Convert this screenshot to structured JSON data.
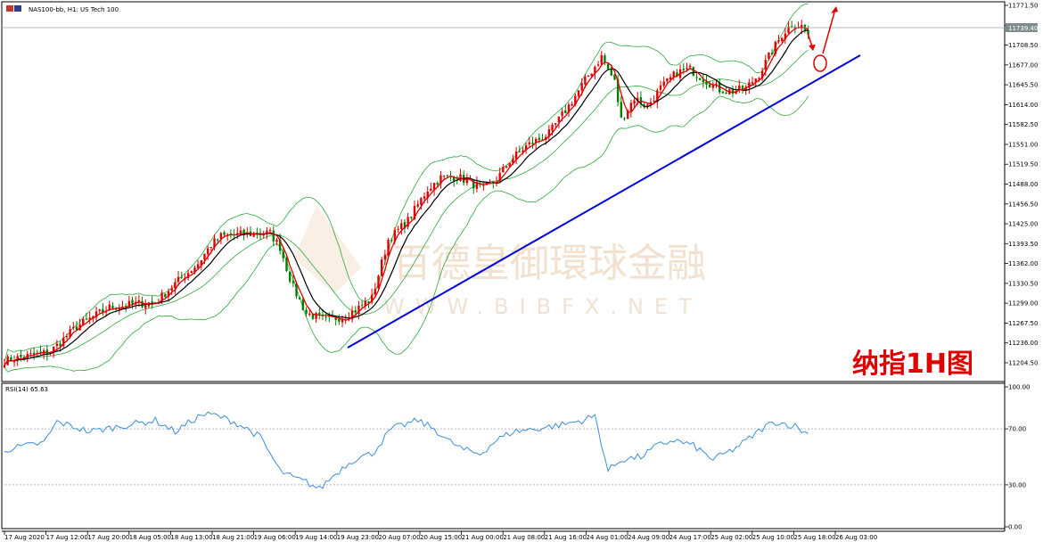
{
  "header": {
    "symbol_text": "NAS100-bb, H1:  US Tech 100",
    "rsi_label": "RSI(14) 65.63"
  },
  "annotation": {
    "title": "纳指1H图",
    "watermark_cn": "百德皇御環球金融",
    "watermark_en": "WWW.BIBFX.NET"
  },
  "colors": {
    "bull": "#e00000",
    "bear": "#008000",
    "trendline": "#0000dd",
    "bands": "#2fa83c",
    "fast_ma": "#e00000",
    "slow_ma": "#000000",
    "rsi": "#3b8ed8",
    "arrow": "#e00000"
  },
  "chart_data": [
    {
      "type": "candlestick",
      "symbol": "NAS100-bb",
      "timeframe": "H1",
      "ylim": [
        11190,
        11775
      ],
      "y_ticks": [
        "11771.50",
        "11739.40",
        "11708.50",
        "11677.00",
        "11645.50",
        "11614.00",
        "11582.50",
        "11551.00",
        "11519.50",
        "11488.00",
        "11456.50",
        "11425.00",
        "11393.50",
        "11362.00",
        "11330.50",
        "11299.00",
        "11267.50",
        "11236.00",
        "11204.50"
      ],
      "current_price": "11739.40",
      "x_ticks": [
        "17 Aug 2020",
        "17 Aug 12:00",
        "17 Aug 20:00",
        "18 Aug 05:00",
        "18 Aug 13:00",
        "18 Aug 21:00",
        "19 Aug 06:00",
        "19 Aug 14:00",
        "19 Aug 23:00",
        "20 Aug 07:00",
        "20 Aug 15:00",
        "21 Aug 00:00",
        "21 Aug 08:00",
        "21 Aug 16:00",
        "24 Aug 01:00",
        "24 Aug 09:00",
        "24 Aug 17:00",
        "25 Aug 02:00",
        "25 Aug 10:00",
        "25 Aug 18:00",
        "26 Aug 03:00"
      ],
      "overlays": [
        "Bollinger Bands",
        "fast moving average (red)",
        "slow moving average (black)",
        "rising trendline (blue)"
      ],
      "close_path": [
        [
          0,
          11208
        ],
        [
          14,
          11222
        ],
        [
          22,
          11262
        ],
        [
          32,
          11292
        ],
        [
          40,
          11298
        ],
        [
          46,
          11300
        ],
        [
          52,
          11330
        ],
        [
          59,
          11362
        ],
        [
          63,
          11392
        ],
        [
          66,
          11405
        ],
        [
          72,
          11408
        ],
        [
          78,
          11410
        ],
        [
          81,
          11410
        ],
        [
          84,
          11388
        ],
        [
          86,
          11355
        ],
        [
          88,
          11324
        ],
        [
          92,
          11283
        ],
        [
          98,
          11272
        ],
        [
          104,
          11279
        ],
        [
          108,
          11292
        ],
        [
          112,
          11307
        ],
        [
          117,
          11400
        ],
        [
          123,
          11430
        ],
        [
          129,
          11480
        ],
        [
          133,
          11498
        ],
        [
          138,
          11500
        ],
        [
          142,
          11490
        ],
        [
          146,
          11480
        ],
        [
          150,
          11495
        ],
        [
          154,
          11525
        ],
        [
          159,
          11548
        ],
        [
          166,
          11568
        ],
        [
          172,
          11612
        ],
        [
          178,
          11660
        ],
        [
          182,
          11690
        ],
        [
          186,
          11650
        ],
        [
          188,
          11590
        ],
        [
          192,
          11625
        ],
        [
          196,
          11612
        ],
        [
          200,
          11640
        ],
        [
          205,
          11665
        ],
        [
          209,
          11670
        ],
        [
          213,
          11655
        ],
        [
          218,
          11638
        ],
        [
          222,
          11635
        ],
        [
          226,
          11640
        ],
        [
          230,
          11662
        ],
        [
          233,
          11690
        ],
        [
          237,
          11725
        ],
        [
          240,
          11742
        ],
        [
          243,
          11738
        ],
        [
          245,
          11725
        ]
      ],
      "n_candles": 246
    },
    {
      "type": "line",
      "indicator": "RSI(14)",
      "value": 65.63,
      "ylim": [
        0,
        100
      ],
      "y_ticks": [
        "100.00",
        "70.00",
        "30.00",
        "0.00"
      ],
      "levels": [
        70,
        30
      ],
      "path": [
        [
          0,
          55
        ],
        [
          12,
          60
        ],
        [
          16,
          75
        ],
        [
          26,
          68
        ],
        [
          38,
          73
        ],
        [
          46,
          76
        ],
        [
          52,
          68
        ],
        [
          60,
          80
        ],
        [
          64,
          80
        ],
        [
          70,
          75
        ],
        [
          74,
          70
        ],
        [
          78,
          64
        ],
        [
          81,
          52
        ],
        [
          84,
          40
        ],
        [
          88,
          35
        ],
        [
          92,
          32
        ],
        [
          96,
          27
        ],
        [
          100,
          36
        ],
        [
          104,
          44
        ],
        [
          108,
          50
        ],
        [
          112,
          52
        ],
        [
          118,
          70
        ],
        [
          126,
          76
        ],
        [
          131,
          70
        ],
        [
          135,
          62
        ],
        [
          140,
          55
        ],
        [
          145,
          52
        ],
        [
          150,
          62
        ],
        [
          155,
          68
        ],
        [
          162,
          70
        ],
        [
          170,
          73
        ],
        [
          176,
          76
        ],
        [
          180,
          79
        ],
        [
          184,
          40
        ],
        [
          188,
          48
        ],
        [
          194,
          50
        ],
        [
          199,
          58
        ],
        [
          204,
          62
        ],
        [
          210,
          58
        ],
        [
          216,
          48
        ],
        [
          222,
          55
        ],
        [
          227,
          63
        ],
        [
          232,
          72
        ],
        [
          235,
          75
        ],
        [
          241,
          72
        ],
        [
          245,
          66
        ]
      ]
    }
  ]
}
